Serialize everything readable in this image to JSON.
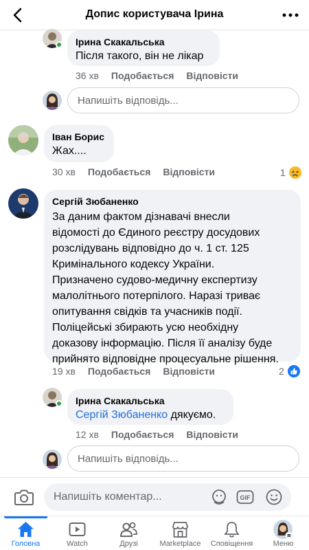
{
  "header": {
    "title": "Допис користувача Ірина"
  },
  "comments": [
    {
      "author": "Ірина Скакальська",
      "text": "Після такого, він не лікар",
      "time": "36 хв",
      "like": "Подобається",
      "reply": "Відповісти"
    },
    {
      "author": "Іван Борис",
      "text": "Жах....",
      "time": "30 хв",
      "like": "Подобається",
      "reply": "Відповісти",
      "reaction_count": "1",
      "reaction_icon": "crying-emoji-icon"
    },
    {
      "author": "Сергій Зюбаненко",
      "text_lines": [
        "За даним фактом дізнавачі внесли",
        "відомості до Єдиного реєстру досудових",
        "розслідувань відповідно до ч. 1 ст. 125",
        "Кримінального кодексу України.",
        "Призначено судово-медичну експертизу",
        "малолітнього потерпілого. Наразі триває",
        "опитування свідків та учасників події.",
        "Поліцейські збирають усю необхідну",
        "доказову інформацію. Після її аналізу буде",
        "прийнято відповідне процесуальне рішення."
      ],
      "time": "19 хв",
      "like": "Подобається",
      "reply": "Відповісти",
      "reaction_count": "2",
      "reaction_icon": "like-icon"
    },
    {
      "author": "Ірина Скакальська",
      "mention": "Сергій Зюбаненко",
      "text": " дякуємо.",
      "time": "12 хв",
      "like": "Подобається",
      "reply": "Відповісти"
    }
  ],
  "reply_placeholder": "Напишіть відповідь...",
  "composer": {
    "placeholder": "Напишіть коментар..."
  },
  "tabs": [
    {
      "label": "Головна",
      "icon": "home-icon",
      "active": true
    },
    {
      "label": "Watch",
      "icon": "watch-icon"
    },
    {
      "label": "Друзі",
      "icon": "friends-icon"
    },
    {
      "label": "Marketplace",
      "icon": "marketplace-icon"
    },
    {
      "label": "Сповіщення",
      "icon": "bell-icon"
    },
    {
      "label": "Меню",
      "icon": "menu-avatar-icon"
    }
  ],
  "colors": {
    "accent": "#1877f2",
    "bubble": "#f0f2f5",
    "muted": "#65676b",
    "mention": "#216fdb"
  }
}
